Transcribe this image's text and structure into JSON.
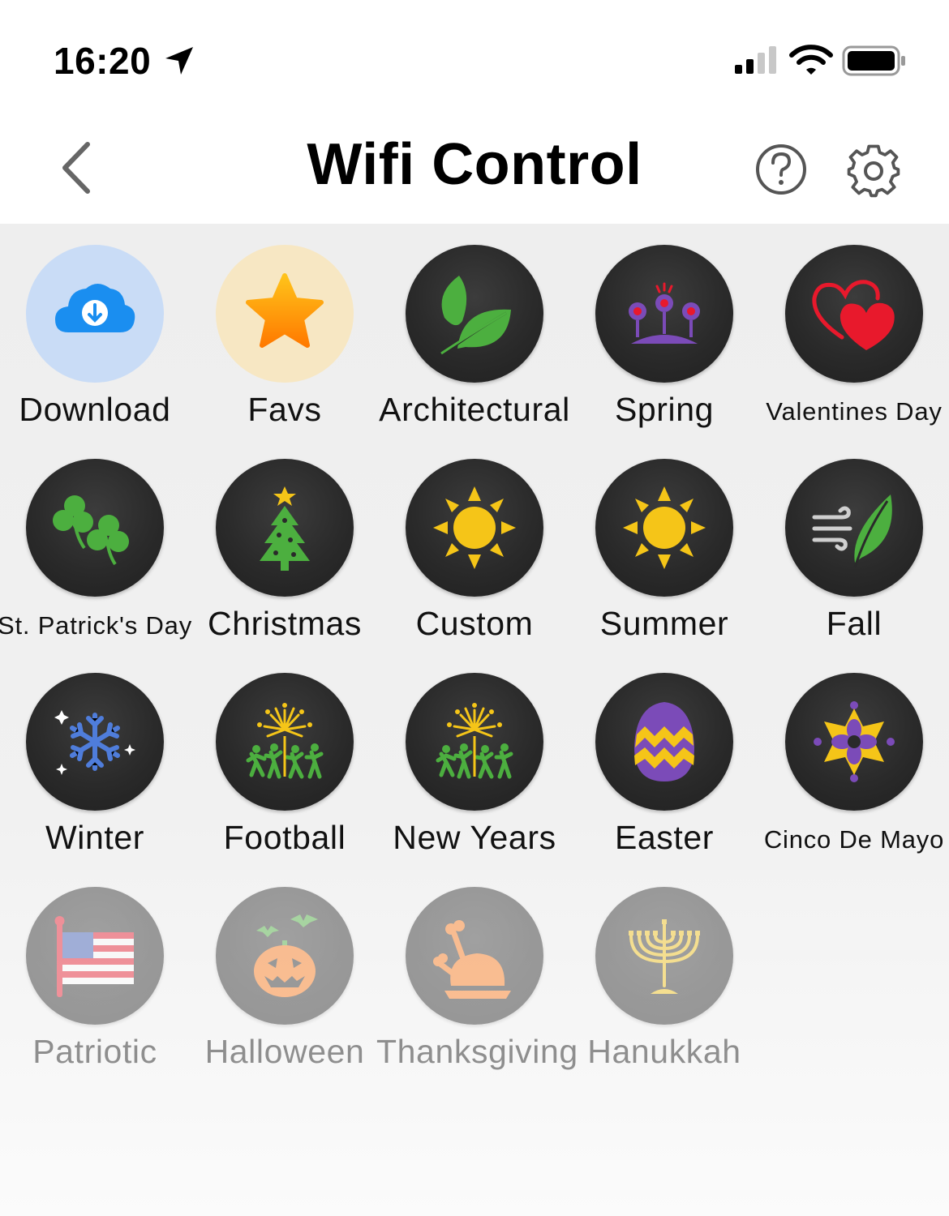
{
  "status_bar": {
    "time": "16:20",
    "icons": [
      "location-arrow-icon",
      "cellular-signal-icon",
      "wifi-icon",
      "battery-icon"
    ]
  },
  "nav": {
    "title": "Wifi Control",
    "back_icon": "chevron-left-icon",
    "help_icon": "question-circle-icon",
    "settings_icon": "gear-icon"
  },
  "tiles": [
    {
      "label": "Download",
      "icon": "cloud-download-icon",
      "enabled": true
    },
    {
      "label": "Favs",
      "icon": "star-icon",
      "enabled": true
    },
    {
      "label": "Architectural",
      "icon": "leaf-icon",
      "enabled": true
    },
    {
      "label": "Spring",
      "icon": "flowers-icon",
      "enabled": true
    },
    {
      "label": "Valentines Day",
      "icon": "hearts-icon",
      "enabled": true
    },
    {
      "label": "St. Patrick's Day",
      "icon": "shamrock-icon",
      "enabled": true
    },
    {
      "label": "Christmas",
      "icon": "christmas-tree-icon",
      "enabled": true
    },
    {
      "label": "Custom",
      "icon": "sun-icon",
      "enabled": true
    },
    {
      "label": "Summer",
      "icon": "sun-icon",
      "enabled": true
    },
    {
      "label": "Fall",
      "icon": "wind-leaf-icon",
      "enabled": true
    },
    {
      "label": "Winter",
      "icon": "snowflake-icon",
      "enabled": true
    },
    {
      "label": "Football",
      "icon": "fireworks-crowd-icon",
      "enabled": true
    },
    {
      "label": "New Years",
      "icon": "fireworks-crowd-icon",
      "enabled": true
    },
    {
      "label": "Easter",
      "icon": "easter-egg-icon",
      "enabled": true
    },
    {
      "label": "Cinco De Mayo",
      "icon": "flower-star-icon",
      "enabled": true
    },
    {
      "label": "Patriotic",
      "icon": "us-flag-icon",
      "enabled": false
    },
    {
      "label": "Halloween",
      "icon": "pumpkin-bats-icon",
      "enabled": false
    },
    {
      "label": "Thanksgiving",
      "icon": "turkey-icon",
      "enabled": false
    },
    {
      "label": "Hanukkah",
      "icon": "menorah-icon",
      "enabled": false
    }
  ],
  "colors": {
    "tile_dark": "#2a2a2a",
    "download_bg": "#c9dcf6",
    "favs_bg": "#f7e7c3",
    "green": "#4caf3f",
    "yellow": "#f5c518",
    "purple": "#7b4bb8",
    "red": "#e8192c"
  }
}
